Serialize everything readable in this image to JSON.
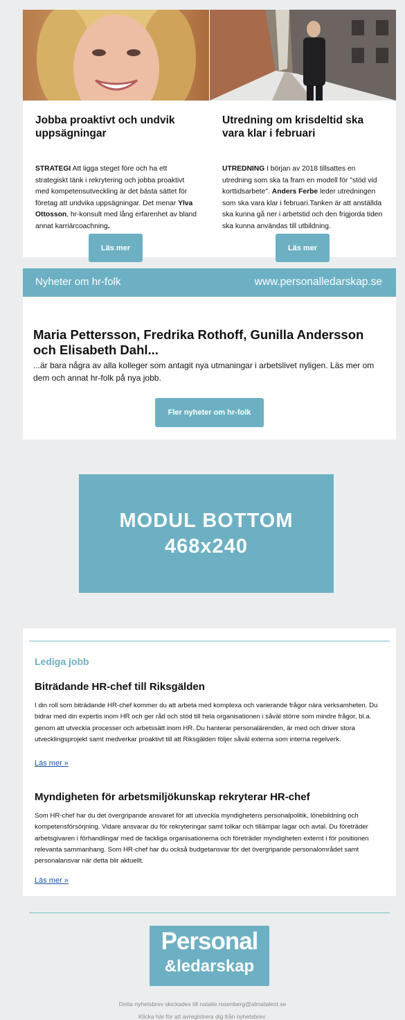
{
  "articles": [
    {
      "title": "Jobba proaktivt och undvik uppsägningar",
      "body_html": "<b>STRATEGI</b> Att ligga steget före och ha ett strategiskt tänk i rekrytering och jobba proaktivt med kompetensutveckling är det bästa sättet för företag att undvika uppsägningar. Det menar <b>Ylva Ottosson</b>, hr-konsult med lång erfarenhet av bland annat karriärcoachning<b>.</b>",
      "button": "Läs mer"
    },
    {
      "title": "Utredning om krisdeltid ska vara klar i februari",
      "body_html": "<b>UTREDNING</b> I början av 2018 tillsattes en utredning som ska ta fram en modell för \"stöd vid korttidsarbete\".  <b>Anders Ferbe</b> leder utredningen som ska vara klar i februari.Tanken är att anställda ska kunna gå ner i arbetstid och den frigjorda tiden ska kunna användas till utbildning.",
      "button": "Läs mer"
    }
  ],
  "banner": {
    "left": "Nyheter om hr-folk",
    "right": "www.personalledarskap.se"
  },
  "hrnews": {
    "heading": "Maria Pettersson, Fredrika Rothoff, Gunilla Andersson och Elisabeth Dahl...",
    "text": "...är bara några av alla kolleger som antagit nya utmaningar i arbetslivet nyligen. Läs mer om dem och annat hr-folk på nya jobb.",
    "button": "Fler nyheter om hr-folk"
  },
  "ad": {
    "line1": "MODUL BOTTOM",
    "line2": "468x240"
  },
  "jobs": {
    "section_title": "Lediga jobb",
    "items": [
      {
        "title": "Biträdande HR-chef till Riksgälden",
        "description": "I din roll som biträdande HR-chef kommer du att arbeta med komplexa och varierande frågor nära verksamheten. Du bidrar med din expertis inom HR och ger råd och stöd till hela organisationen i såväl större som mindre frågor, bl.a. genom att utveckla processer och arbetssätt inom HR. Du hanterar personalärenden, är med och driver stora utvecklingsprojekt samt medverkar proaktivt till att Riksgälden följer såväl externa som interna regelverk.",
        "link": "Läs mer »"
      },
      {
        "title": "Myndigheten för arbetsmiljökunskap rekryterar HR-chef",
        "description": "Som HR-chef har du det övergripande ansvaret för att utveckla myndighetens personalpolitik, lönebildning och kompetensförsörjning. Vidare ansvarar du för rekryteringar samt tolkar och tillämpar lagar och avtal. Du företräder arbetsgivaren i förhandlingar med de fackliga organisationerna och företräder myndigheten externt i för positionen relevanta sammanhang. Som HR-chef har du också budgetansvar för det övergripande personalområdet samt personalansvar när detta blir aktuellt.",
        "link": "Läs mer »"
      }
    ]
  },
  "footer": {
    "logo_line1": "Personal",
    "logo_line2": "&ledarskap",
    "sent_to": "Detta nyhetsbrev skickades till natalie.rosenberg@almatalent.se",
    "unsubscribe": "Klicka här för att avregistrera dig från nyhetsbrev."
  },
  "colors": {
    "accent": "#6db0c3",
    "page_bg": "#ecedee",
    "link": "#1a4fa8"
  }
}
